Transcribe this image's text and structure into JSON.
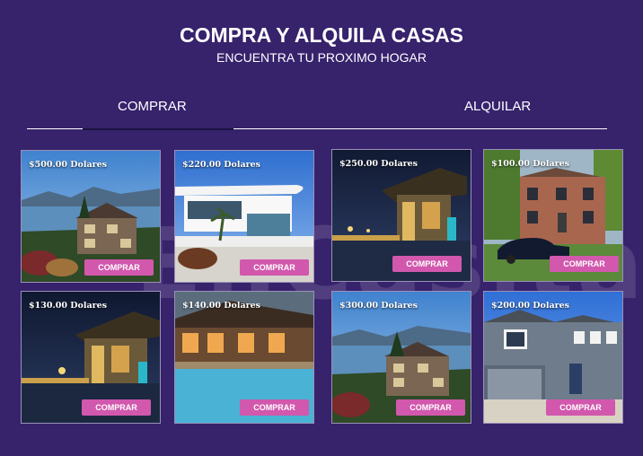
{
  "header": {
    "title": "COMPRA Y ALQUILA CASAS",
    "subtitle": "ENCUENTRA TU PROXIMO HOGAR"
  },
  "watermark": "EnCasita",
  "tabs": [
    {
      "label": "COMPRAR",
      "active": true
    },
    {
      "label": "ALQUILAR",
      "active": false
    }
  ],
  "colors": {
    "background": "#37226c",
    "button": "#d158ad",
    "active_tab_underline": "#1c1240"
  },
  "listings": [
    {
      "price": "$500.00 Dolares",
      "button": "COMPRAR",
      "scene": "lake-house"
    },
    {
      "price": "$220.00 Dolares",
      "button": "COMPRAR",
      "scene": "modern-house"
    },
    {
      "price": "$250.00 Dolares",
      "button": "COMPRAR",
      "scene": "night-house"
    },
    {
      "price": "$100.00 Dolares",
      "button": "COMPRAR",
      "scene": "brick-house"
    },
    {
      "price": "$130.00 Dolares",
      "button": "COMPRAR",
      "scene": "night-house"
    },
    {
      "price": "$140.00 Dolares",
      "button": "COMPRAR",
      "scene": "lodge-pool"
    },
    {
      "price": "$300.00 Dolares",
      "button": "COMPRAR",
      "scene": "lake-house"
    },
    {
      "price": "$200.00 Dolares",
      "button": "COMPRAR",
      "scene": "suburban-house"
    }
  ]
}
